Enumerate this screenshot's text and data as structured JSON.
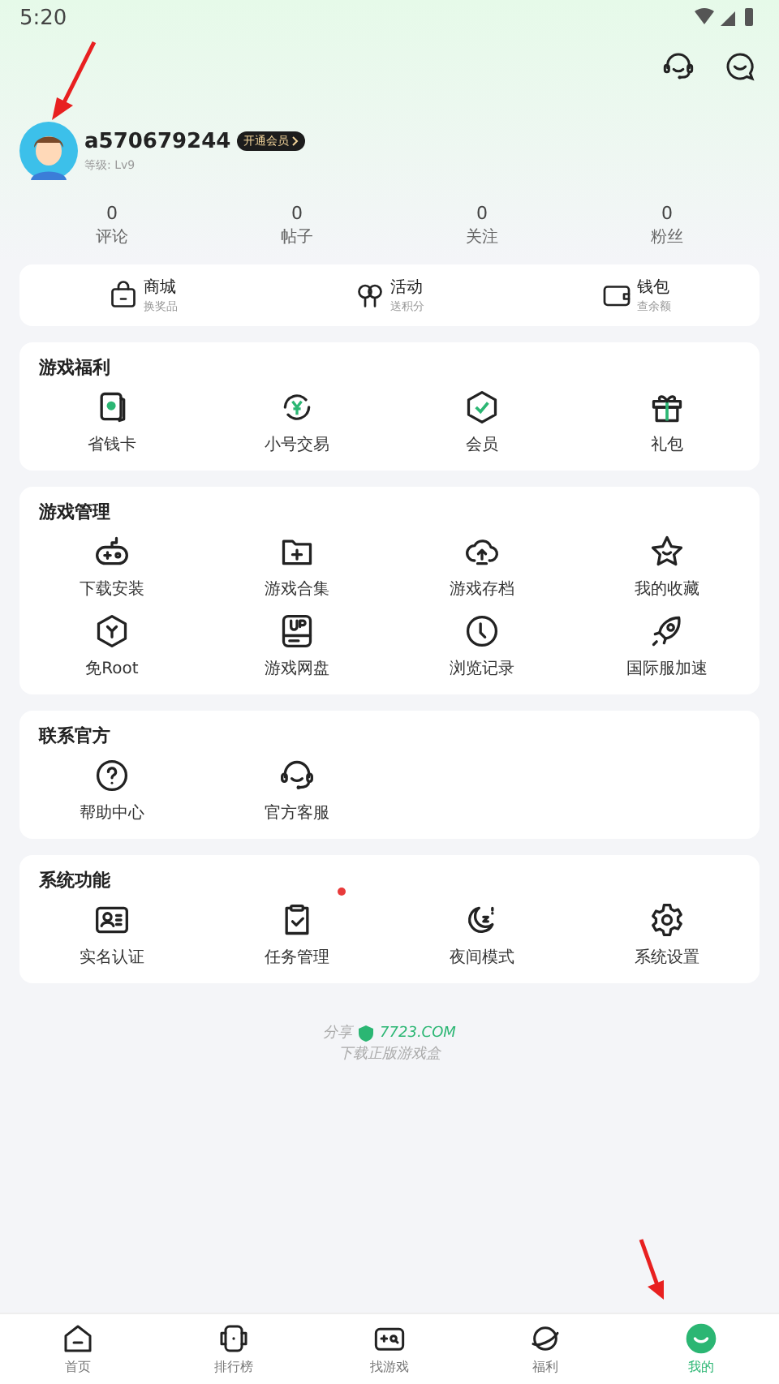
{
  "status_bar": {
    "time": "5:20"
  },
  "profile": {
    "username": "a570679244",
    "vip_badge": "开通会员",
    "level": "等级: Lv9"
  },
  "stats": [
    {
      "value": "0",
      "label": "评论"
    },
    {
      "value": "0",
      "label": "帖子"
    },
    {
      "value": "0",
      "label": "关注"
    },
    {
      "value": "0",
      "label": "粉丝"
    }
  ],
  "shortcuts": [
    {
      "title": "商城",
      "subtitle": "换奖品"
    },
    {
      "title": "活动",
      "subtitle": "送积分"
    },
    {
      "title": "钱包",
      "subtitle": "查余额"
    }
  ],
  "sections": [
    {
      "title": "游戏福利",
      "items": [
        {
          "label": "省钱卡"
        },
        {
          "label": "小号交易"
        },
        {
          "label": "会员"
        },
        {
          "label": "礼包"
        }
      ]
    },
    {
      "title": "游戏管理",
      "items": [
        {
          "label": "下载安装"
        },
        {
          "label": "游戏合集"
        },
        {
          "label": "游戏存档"
        },
        {
          "label": "我的收藏"
        },
        {
          "label": "免Root"
        },
        {
          "label": "游戏网盘"
        },
        {
          "label": "浏览记录"
        },
        {
          "label": "国际服加速"
        }
      ]
    },
    {
      "title": "联系官方",
      "items": [
        {
          "label": "帮助中心"
        },
        {
          "label": "官方客服"
        }
      ]
    },
    {
      "title": "系统功能",
      "items": [
        {
          "label": "实名认证",
          "dot": false
        },
        {
          "label": "任务管理",
          "dot": true
        },
        {
          "label": "夜间模式",
          "dot": false
        },
        {
          "label": "系统设置",
          "dot": false
        }
      ]
    }
  ],
  "footer": {
    "share": "分享",
    "site": "7723.COM",
    "slogan": "下载正版游戏盒"
  },
  "nav": [
    {
      "label": "首页",
      "selected": false
    },
    {
      "label": "排行榜",
      "selected": false
    },
    {
      "label": "找游戏",
      "selected": false
    },
    {
      "label": "福利",
      "selected": false
    },
    {
      "label": "我的",
      "selected": true
    }
  ]
}
